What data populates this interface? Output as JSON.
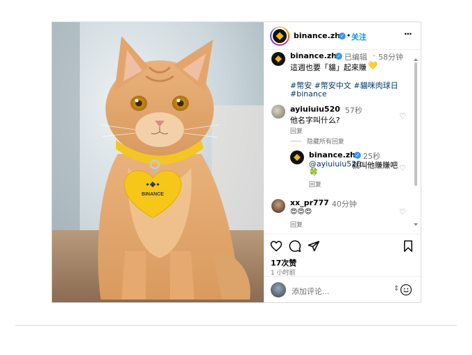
{
  "post": {
    "author": "binance.zh",
    "follow_label": "关注",
    "more_label": "···",
    "caption": {
      "author": "binance.zh",
      "edited_label": "已编辑",
      "time": "58分钟",
      "text": "這週也要「貓」起來賺",
      "emoji": "💛",
      "hashtags_line1": "#幣安 #幣安中文 #貓咪肉球日",
      "hashtags_line2": "#binance"
    },
    "comments": [
      {
        "user": "ayiuiuiu520",
        "time": "57秒",
        "text": "他名字叫什么?",
        "reply_label": "回复"
      },
      {
        "user": "xx_pr777",
        "time": "40分钟",
        "text": "😍😍😍",
        "reply_label": "回复"
      }
    ],
    "hide_replies_label": "隐藏所有回复",
    "reply": {
      "user": "binance.zh",
      "time": "25秒",
      "mention": "@ayiuiuiu520",
      "text": " 就叫他賺賺吧",
      "emoji": "🍀",
      "reply_label": "回复"
    },
    "likes": "17次赞",
    "posted_time": "1 小时前",
    "add_comment_placeholder": "添加评论...",
    "photo_logo_text": "BINANCE"
  },
  "colors": {
    "brand_yellow": "#f0b90b",
    "link_blue": "#0095f6",
    "hashtag": "#00376b"
  },
  "icons": [
    "verified-icon",
    "more-icon",
    "heart-icon",
    "comment-icon",
    "share-icon",
    "bookmark-icon",
    "emoji-icon"
  ]
}
